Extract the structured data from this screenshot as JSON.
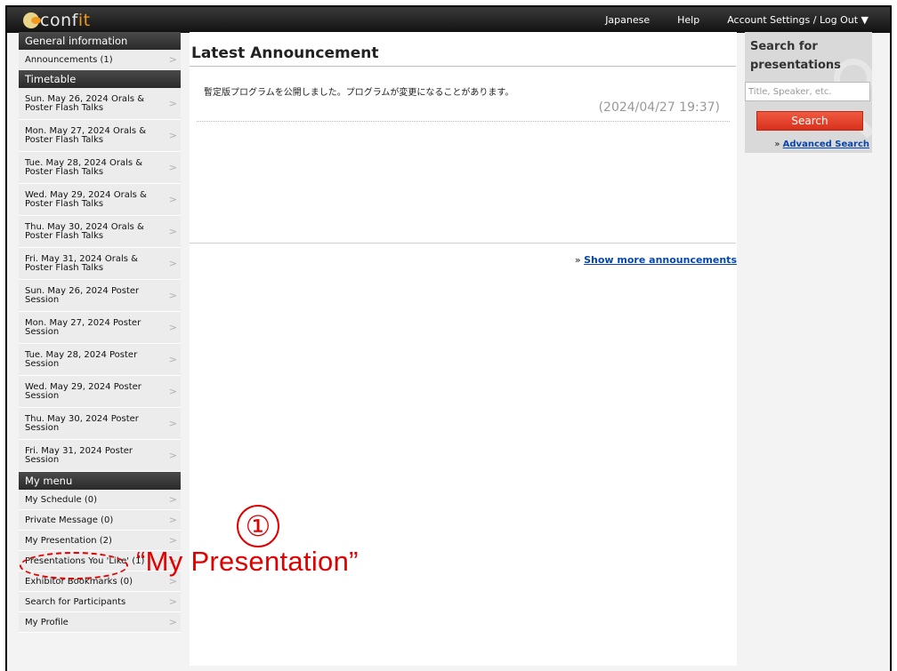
{
  "header": {
    "logo_text_prefix": "conf",
    "logo_text_highlight": "it",
    "links": [
      "Japanese",
      "Help",
      "Account Settings / Log Out ▼"
    ]
  },
  "sidebar": {
    "general": {
      "header": "General information",
      "items": [
        {
          "label": "Announcements (1)"
        }
      ]
    },
    "timetable": {
      "header": "Timetable",
      "items": [
        {
          "line1": "Sun. May 26, 2024 Orals &",
          "line2": "Poster Flash Talks"
        },
        {
          "line1": "Mon. May 27, 2024 Orals &",
          "line2": "Poster Flash Talks"
        },
        {
          "line1": "Tue. May 28, 2024 Orals &",
          "line2": "Poster Flash Talks"
        },
        {
          "line1": "Wed. May 29, 2024 Orals &",
          "line2": "Poster Flash Talks"
        },
        {
          "line1": "Thu. May 30, 2024 Orals &",
          "line2": "Poster Flash Talks"
        },
        {
          "line1": "Fri. May 31, 2024 Orals &",
          "line2": "Poster Flash Talks"
        },
        {
          "line1": "Sun. May 26, 2024 Poster",
          "line2": "Session"
        },
        {
          "line1": "Mon. May 27, 2024 Poster",
          "line2": "Session"
        },
        {
          "line1": "Tue. May 28, 2024 Poster",
          "line2": "Session"
        },
        {
          "line1": "Wed. May 29, 2024 Poster",
          "line2": "Session"
        },
        {
          "line1": "Thu. May 30, 2024 Poster",
          "line2": "Session"
        },
        {
          "line1": "Fri. May 31, 2024 Poster",
          "line2": "Session"
        }
      ]
    },
    "mymenu": {
      "header": "My menu",
      "items": [
        {
          "label": "My Schedule (0)"
        },
        {
          "label": "Private Message (0)"
        },
        {
          "label": "My Presentation (2)"
        },
        {
          "label": "Presentations You 'Like' (1)"
        },
        {
          "label": "Exhibitor Bookmarks (0)"
        },
        {
          "label": "Search for Participants"
        },
        {
          "label": "My Profile"
        }
      ]
    },
    "chevron": ">"
  },
  "main": {
    "title": "Latest Announcement",
    "announcement": {
      "text": "暫定版プログラムを公開しました。プログラムが変更になることがあります。",
      "date": "(2024/04/27 19:37)"
    },
    "show_more_prefix": "» ",
    "show_more": "Show more announcements"
  },
  "search": {
    "title_line1": "Search for",
    "title_line2": "presentations",
    "placeholder": "Title, Speaker, etc.",
    "button": "Search",
    "advanced_prefix": "» ",
    "advanced": "Advanced Search"
  },
  "callout": {
    "number": "①",
    "text": "“My Presentation”",
    "color": "#e00000"
  }
}
